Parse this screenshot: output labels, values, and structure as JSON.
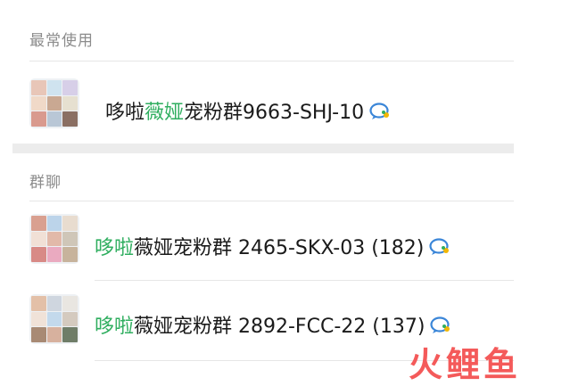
{
  "sections": {
    "recent": "最常使用",
    "groups": "群聊"
  },
  "recent_items": [
    {
      "name_pre": "哆啦",
      "name_hl": "薇娅",
      "name_post": "宠粉群9663-SHJ-10",
      "icon": "wechat-work-bubble-icon"
    }
  ],
  "group_items": [
    {
      "name_hl": "哆啦",
      "name_post": "薇娅宠粉群 2465-SKX-03 (182)",
      "icon": "wechat-work-bubble-icon"
    },
    {
      "name_hl": "哆啦",
      "name_post": "薇娅宠粉群 2892-FCC-22 (137)",
      "icon": "wechat-work-bubble-icon"
    }
  ],
  "watermark": "火鲤鱼",
  "colors": {
    "highlight": "#2fae5f",
    "watermark": "#f45a5a",
    "section_label": "#8c8c8c"
  }
}
